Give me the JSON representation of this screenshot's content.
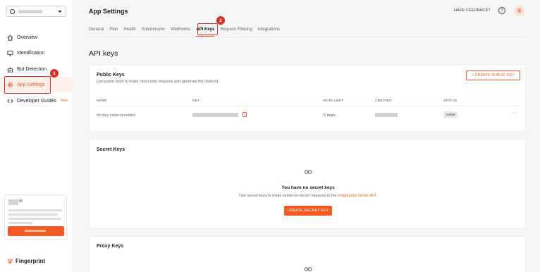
{
  "sidebar": {
    "items": [
      {
        "label": "Overview",
        "icon": "home-icon"
      },
      {
        "label": "Identification",
        "icon": "monitor-icon"
      },
      {
        "label": "Bot Detection",
        "icon": "bot-icon"
      },
      {
        "label": "App Settings",
        "icon": "gear-icon",
        "active": true,
        "badge": "1"
      },
      {
        "label": "Developer Guides",
        "icon": "code-icon",
        "tag": "New"
      }
    ],
    "brand": "Fingerprint"
  },
  "header": {
    "title": "App Settings",
    "feedback": "HAVE FEEDBACK?",
    "help": "?"
  },
  "tabs": [
    {
      "label": "General"
    },
    {
      "label": "Plan"
    },
    {
      "label": "Health"
    },
    {
      "label": "Subdomains"
    },
    {
      "label": "Webhooks"
    },
    {
      "label": "API Keys",
      "active": true,
      "badge": "2"
    },
    {
      "label": "Request Filtering"
    },
    {
      "label": "Integrations"
    }
  ],
  "main": {
    "section_title": "API keys",
    "public_keys": {
      "title": "Public Keys",
      "description": "Use public keys to make client-side requests and generate the visitorId.",
      "create_button": "+ CREATE PUBLIC KEY",
      "columns": [
        "NAME",
        "KEY",
        "RATE LIMIT",
        "CREATED",
        "STATUS"
      ],
      "rows": [
        {
          "name": "No key name provided",
          "rate_limit": "5 req/s",
          "status": "Active",
          "more": "···"
        }
      ]
    },
    "secret_keys": {
      "title": "Secret Keys",
      "empty_title": "You have no secret keys",
      "empty_desc_prefix": "Use secret keys to make server-to-server requests to the ",
      "empty_desc_link": "Fingerprint Server API",
      "empty_desc_suffix": ".",
      "create_button": "CREATE SECRET KEY"
    },
    "proxy_keys": {
      "title": "Proxy Keys"
    }
  },
  "colors": {
    "accent": "#f35b22",
    "highlight": "#d93025"
  }
}
